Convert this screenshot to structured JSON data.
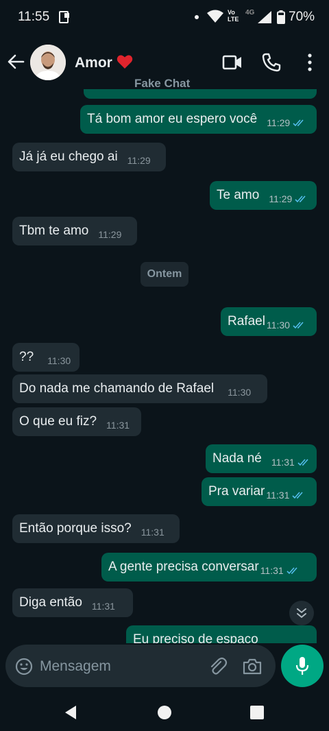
{
  "status_bar": {
    "time": "11:55",
    "volte_top": "Vo",
    "volte_bottom": "LTE",
    "network": "4G",
    "battery": "70%"
  },
  "header": {
    "contact_name": "Amor",
    "subtitle": "Fake Chat"
  },
  "messages": [
    {
      "dir": "out",
      "text": "Tá bom amor eu espero você",
      "time": "11:29"
    },
    {
      "dir": "in",
      "text": "Já já eu chego ai",
      "time": "11:29"
    },
    {
      "dir": "out",
      "text": "Te amo",
      "time": "11:29"
    },
    {
      "dir": "in",
      "text": "Tbm te amo",
      "time": "11:29"
    },
    {
      "dir": "out",
      "text": "Rafael",
      "time": "11:30"
    },
    {
      "dir": "in",
      "text": "??",
      "time": "11:30"
    },
    {
      "dir": "in",
      "text": "Do nada me chamando de Rafael",
      "time": "11:30"
    },
    {
      "dir": "in",
      "text": "O que eu fiz?",
      "time": "11:31"
    },
    {
      "dir": "out",
      "text": "Nada né",
      "time": "11:31"
    },
    {
      "dir": "out",
      "text": "Pra variar",
      "time": "11:31"
    },
    {
      "dir": "in",
      "text": "Então porque isso?",
      "time": "11:31"
    },
    {
      "dir": "out",
      "text": "A gente precisa conversar",
      "time": "11:31"
    },
    {
      "dir": "in",
      "text": "Diga então",
      "time": "11:31"
    },
    {
      "dir": "out",
      "text": "Eu preciso de espaço"
    }
  ],
  "day_divider": "Ontem",
  "input": {
    "placeholder": "Mensagem"
  },
  "colors": {
    "background": "#0b141a",
    "incoming": "#202c33",
    "outgoing": "#005c4b",
    "accent": "#00a884",
    "read_ticks": "#53bdeb"
  },
  "icons": [
    "back-arrow-icon",
    "heart-icon",
    "video-call-icon",
    "phone-icon",
    "more-vert-icon",
    "double-check-icon",
    "chevron-double-down-icon",
    "emoji-icon",
    "paperclip-icon",
    "camera-icon",
    "mic-icon"
  ]
}
